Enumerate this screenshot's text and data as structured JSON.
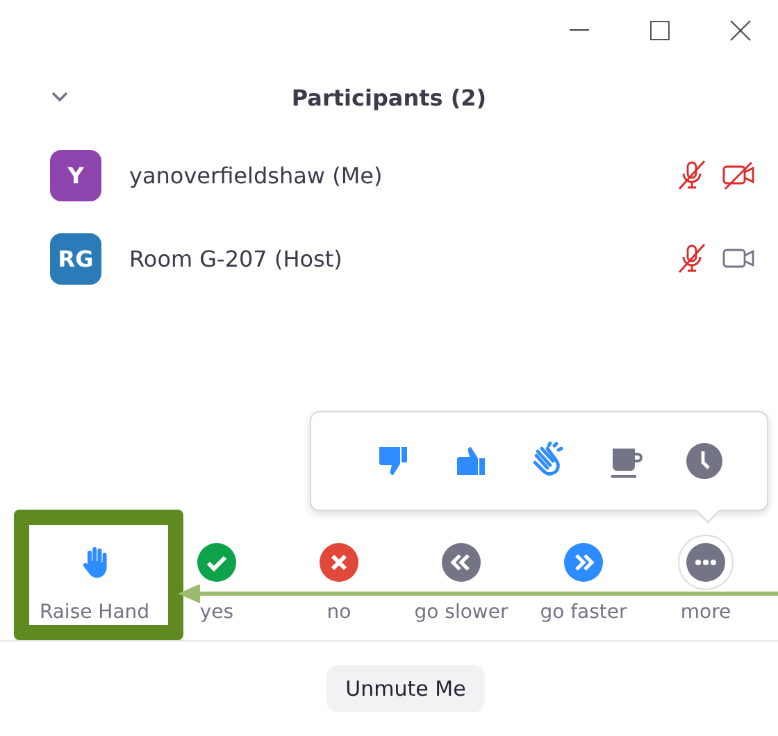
{
  "header": {
    "title": "Participants (2)",
    "collapsed": false
  },
  "participants": [
    {
      "initials": "Y",
      "color": "#8e44ad",
      "name": "yanoverfieldshaw (Me)",
      "mic_muted": true,
      "video_on": false
    },
    {
      "initials": "RG",
      "color": "#2b7bb9",
      "name": "Room G-207 (Host)",
      "mic_muted": true,
      "video_on": true
    }
  ],
  "popup": [
    {
      "kind": "thumbs_down"
    },
    {
      "kind": "thumbs_up"
    },
    {
      "kind": "clap"
    },
    {
      "kind": "coffee"
    },
    {
      "kind": "clock"
    }
  ],
  "reactions": [
    {
      "kind": "raise_hand",
      "label": "Raise Hand",
      "selected": false
    },
    {
      "kind": "yes",
      "label": "yes",
      "selected": false
    },
    {
      "kind": "no",
      "label": "no",
      "selected": false
    },
    {
      "kind": "slower",
      "label": "go slower",
      "selected": false
    },
    {
      "kind": "faster",
      "label": "go faster",
      "selected": false
    },
    {
      "kind": "more",
      "label": "more",
      "selected": true
    }
  ],
  "button": "Unmute Me"
}
